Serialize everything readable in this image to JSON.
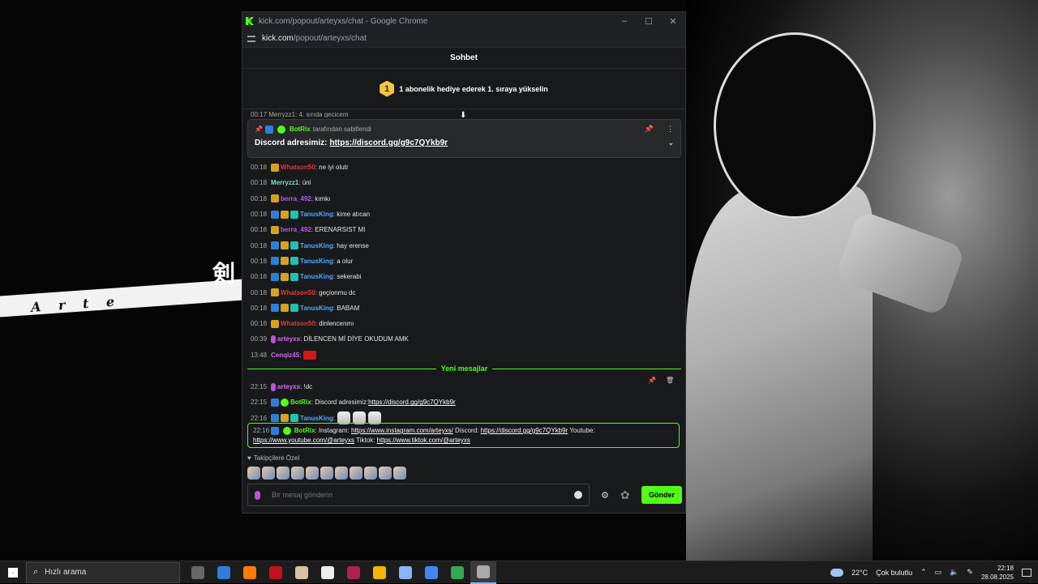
{
  "window": {
    "title": "kick.com/popout/arteyxs/chat - Google Chrome",
    "url_host": "kick.com",
    "url_path": "/popout/arteyxs/chat",
    "controls": {
      "minimize": "–",
      "maximize": "☐",
      "close": "✕"
    }
  },
  "chat": {
    "header": "Sohbet",
    "gift_rank": "1",
    "gift_text": "1 abonelik hediye ederek 1. sıraya yükselin",
    "cut_message": "00:17  Merryzz1: 4. sırıda gecicem",
    "pinned": {
      "pin_user": "BotRix",
      "pin_by": "tarafından sabitlendi",
      "prefix": "Discord adresimiz:",
      "link": "https://discord.gg/g9c7QYkb9r"
    },
    "messages": [
      {
        "ts": "00:18",
        "badges": [
          "crown"
        ],
        "user": "Whatson50",
        "color": "#e23a3a",
        "text": ": ne iyi olutr"
      },
      {
        "ts": "00:18",
        "badges": [],
        "user": "Merryzz1",
        "color": "#7fe0c0",
        "text": ": ünl"
      },
      {
        "ts": "00:18",
        "badges": [
          "crown"
        ],
        "user": "berra_492",
        "color": "#b45ef0",
        "text": ": kımkı"
      },
      {
        "ts": "00:18",
        "badges": [
          "blue",
          "crown",
          "teal"
        ],
        "user": "TanusKing",
        "color": "#4fa8ff",
        "text": ": kime atıcan"
      },
      {
        "ts": "00:18",
        "badges": [
          "crown"
        ],
        "user": "berra_492",
        "color": "#b45ef0",
        "text": ": ERENARSIST MI"
      },
      {
        "ts": "00:18",
        "badges": [
          "blue",
          "crown",
          "teal"
        ],
        "user": "TanusKing",
        "color": "#4fa8ff",
        "text": ": hay erense"
      },
      {
        "ts": "00:18",
        "badges": [
          "blue",
          "crown",
          "teal"
        ],
        "user": "TanusKing",
        "color": "#4fa8ff",
        "text": ": a olur"
      },
      {
        "ts": "00:18",
        "badges": [
          "blue",
          "crown",
          "teal"
        ],
        "user": "TanusKing",
        "color": "#4fa8ff",
        "text": ": sekerabi"
      },
      {
        "ts": "00:18",
        "badges": [
          "crown"
        ],
        "user": "Whatson50",
        "color": "#e23a3a",
        "text": ": geçionmu dc"
      },
      {
        "ts": "00:18",
        "badges": [
          "blue",
          "crown",
          "teal"
        ],
        "user": "TanusKing",
        "color": "#4fa8ff",
        "text": ": BABAM"
      },
      {
        "ts": "00:18",
        "badges": [
          "crown"
        ],
        "user": "Whatson50",
        "color": "#e23a3a",
        "text": ": dinlencenmı"
      },
      {
        "ts": "00:39",
        "badges": [
          "mic"
        ],
        "user": "arteyxs",
        "color": "#d66bff",
        "text": ": DİLENCEN Mİ DİYE OKUDUM AMK"
      },
      {
        "ts": "13:48",
        "badges": [],
        "user": "Cenqiz45",
        "color": "#c56bf0",
        "text": ":",
        "emote": "flag"
      }
    ],
    "divider": "Yeni mesajlar",
    "hover_tools": {
      "pin": "📌",
      "delete": "🗑"
    },
    "new_messages": [
      {
        "ts": "22:15",
        "badges": [
          "mic"
        ],
        "user": "arteyxs",
        "color": "#d66bff",
        "text": ": !dc"
      },
      {
        "ts": "22:15",
        "badges": [
          "blue",
          "verified"
        ],
        "user": "BotRix",
        "color": "#53fc18",
        "text": ": Discord adresimiz: ",
        "link": "https://discord.gg/g9c7QYkb9r"
      },
      {
        "ts": "22:16",
        "badges": [
          "blue",
          "crown",
          "teal"
        ],
        "user": "TanusKing",
        "color": "#4fa8ff",
        "text": ":",
        "emotes": 3
      }
    ],
    "highlight": {
      "ts": "22:16",
      "user": "BotRix",
      "seg1": ": Instagram: ",
      "link1": "https://www.instagram.com/arteyxs/",
      "seg2": " Discord: ",
      "link2": "https://discord.gg/g9c7QYkb9r",
      "seg3": " Youtube: ",
      "link3": "https://www.youtube.com/@arteyxs",
      "seg4": " Tiktok: ",
      "link4": "https://www.tiktok.com/@arteyxs"
    },
    "emote_section_title": "Takipçilere Özel",
    "emote_count": 11,
    "input_placeholder": "Bir mesaj gönderin",
    "send_label": "Gönder"
  },
  "desktop": {
    "stripe_text": "A r t e",
    "kanji": "剣"
  },
  "taskbar": {
    "search_placeholder": "Hızlı arama",
    "weather_temp": "22°C",
    "weather_text": "Çok bulutlu",
    "time": "22:18",
    "date": "28.08.2025",
    "apps": [
      {
        "name": "task-view",
        "color": "#666"
      },
      {
        "name": "app-blue",
        "color": "#2f7fd8"
      },
      {
        "name": "illustrator",
        "color": "#ff7c00"
      },
      {
        "name": "app-red",
        "color": "#c0101f"
      },
      {
        "name": "app-anime",
        "color": "#d8c0a0"
      },
      {
        "name": "capcut",
        "color": "#eeeeee"
      },
      {
        "name": "kick-app",
        "color": "#b0204f"
      },
      {
        "name": "chrome",
        "color": "#f4b400"
      },
      {
        "name": "notepad",
        "color": "#8ab4f8"
      },
      {
        "name": "chrome-profile",
        "color": "#4285f4"
      },
      {
        "name": "chrome-2",
        "color": "#34a853"
      },
      {
        "name": "obs",
        "color": "#aaaaaa"
      }
    ]
  }
}
